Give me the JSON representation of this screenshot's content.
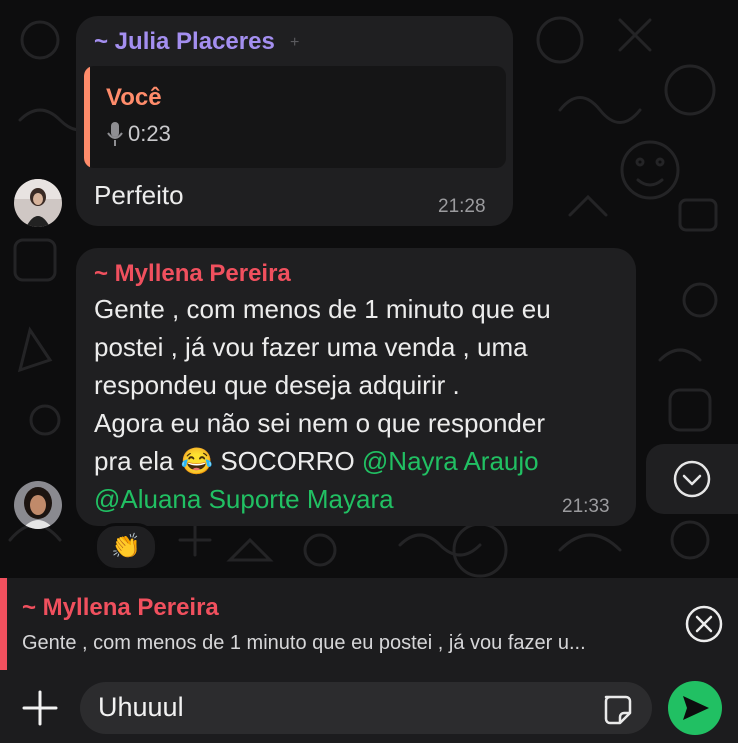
{
  "messages": [
    {
      "sender": "~ Julia Placeres",
      "sender_color": "#a48ff0",
      "quote": {
        "author": "Você",
        "author_color": "#ff8c6b",
        "audio_duration": "0:23",
        "icon": "microphone-icon"
      },
      "text": "Perfeito",
      "time": "21:28"
    },
    {
      "sender": "~ Myllena Pereira",
      "sender_color": "#f0505e",
      "lines": [
        "Gente , com menos de 1 minuto que eu",
        "postei , já vou fazer uma venda , uma",
        "respondeu que deseja adquirir .",
        "Agora eu não sei nem o que responder"
      ],
      "line5_prefix": "pra ela",
      "emoji": "😂",
      "line5_mid": " SOCORRO ",
      "mention1": "@Nayra Araujo",
      "mention2": "@Aluana Suporte Mayara",
      "time": "21:33",
      "reaction": "👏"
    }
  ],
  "reply_preview": {
    "sender": "~ Myllena Pereira",
    "text": "Gente , com menos de 1 minuto que eu postei , já vou fazer u...",
    "accent": "#f0505e"
  },
  "composer": {
    "value": "Uhuuul",
    "add_icon": "plus-icon",
    "sticker_icon": "sticker-icon",
    "send_icon": "send-icon",
    "send_color": "#21c063"
  },
  "scroll_down_icon": "chevron-down-icon"
}
